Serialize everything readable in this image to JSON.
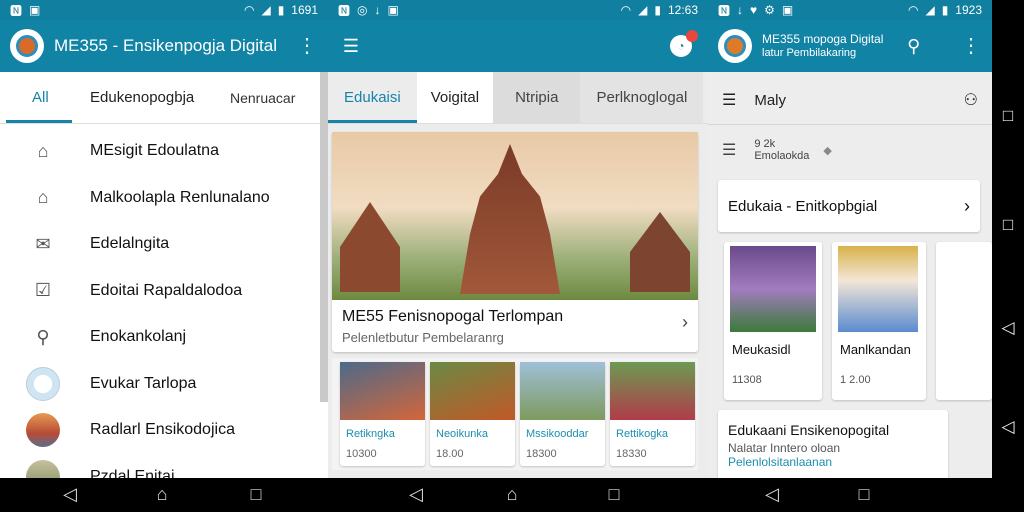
{
  "status_bar": {
    "left_icons_1": [
      "notification-n-icon",
      "photo-icon"
    ],
    "right_icons": [
      "wifi-icon",
      "signal-icon",
      "battery-icon"
    ],
    "time_1": "1691",
    "time_2": "12:63",
    "time_3": "1923"
  },
  "screen1": {
    "app_title": "ME355 - Ensikenpogja Digital",
    "tabs": [
      {
        "label": "All"
      },
      {
        "label": "Edukenopogbja"
      },
      {
        "label": "Nenruacar"
      }
    ],
    "menu": [
      {
        "label": "MEsigit Edoulatna",
        "icon": "home-icon"
      },
      {
        "label": "Malkoolapla Renlunalano",
        "icon": "building-icon"
      },
      {
        "label": "Edelalngita",
        "icon": "mail-icon"
      },
      {
        "label": "Edoitai Rapaldalodoa",
        "icon": "check-mail-icon"
      },
      {
        "label": "Enokankolanj",
        "icon": "search-icon"
      },
      {
        "label": "Evukar Tarlopa",
        "icon": "avatar-sail"
      },
      {
        "label": "Radlarl Ensikodojica",
        "icon": "avatar-group"
      },
      {
        "label": "Pzdal Enitai",
        "icon": "avatar-small"
      }
    ]
  },
  "screen2": {
    "tabs": [
      {
        "label": "Edukaisi"
      },
      {
        "label": "Voigital"
      },
      {
        "label": "Ntripia"
      },
      {
        "label": "Perlknoglogal"
      }
    ],
    "hero": {
      "title": "ME55 Fenisnopogal Terlompan",
      "subtitle": "Pelenletbutur Pembelaranrg"
    },
    "thumbs": [
      {
        "caption": "Retikngka",
        "value": "10300"
      },
      {
        "caption": "Neoikunka",
        "value": "18.00"
      },
      {
        "caption": "Mssikooddar",
        "value": "18300"
      },
      {
        "caption": "Rettikogka",
        "value": "18330"
      }
    ]
  },
  "screen3": {
    "header_title": "ME355 mopoga Digital",
    "header_sub": "latur Pembilakaring",
    "row1_label": "Maly",
    "row2_value": "9 2k",
    "row2_label": "Emolaokda",
    "section_card": "Edukaia - Enitkopbgial",
    "cards": [
      {
        "caption": "Meukasidl",
        "value": "11308"
      },
      {
        "caption": "Manlkandan",
        "value": "1 2.00"
      }
    ],
    "bottom_card": {
      "title": "Edukaani Ensikenopogital",
      "line1": "Nalatar Inntero oloan",
      "line2": "Pelenlolsitanlaanan"
    }
  },
  "colors": {
    "appbar": "#1183a5",
    "accent": "#1783a9"
  }
}
